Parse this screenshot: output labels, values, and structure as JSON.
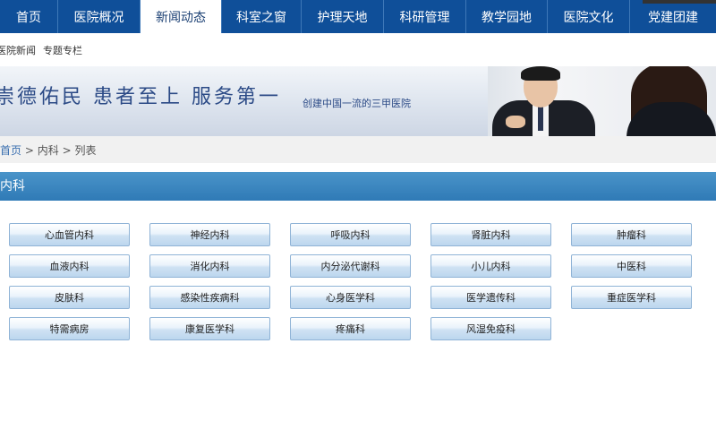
{
  "nav": {
    "items": [
      {
        "label": "首页"
      },
      {
        "label": "医院概况"
      },
      {
        "label": "新闻动态"
      },
      {
        "label": "科室之窗"
      },
      {
        "label": "护理天地"
      },
      {
        "label": "科研管理"
      },
      {
        "label": "教学园地"
      },
      {
        "label": "医院文化"
      },
      {
        "label": "党建团建"
      }
    ],
    "active_index": 2
  },
  "subnav": {
    "items": [
      {
        "label": "医院新闻"
      },
      {
        "label": "专题专栏"
      }
    ]
  },
  "banner": {
    "slogan": "崇德佑民  患者至上   服务第一",
    "tagline": "创建中国一流的三甲医院"
  },
  "breadcrumb": {
    "home": "首页",
    "sep1": ">",
    "section": "内科",
    "sep2": ">",
    "current": "列表"
  },
  "section": {
    "title": "内科"
  },
  "departments": [
    {
      "label": "心血管内科"
    },
    {
      "label": "神经内科"
    },
    {
      "label": "呼吸内科"
    },
    {
      "label": "肾脏内科"
    },
    {
      "label": "肿瘤科"
    },
    {
      "label": "血液内科"
    },
    {
      "label": "消化内科"
    },
    {
      "label": "内分泌代谢科"
    },
    {
      "label": "小儿内科"
    },
    {
      "label": "中医科"
    },
    {
      "label": "皮肤科"
    },
    {
      "label": "感染性疾病科"
    },
    {
      "label": "心身医学科"
    },
    {
      "label": "医学遗传科"
    },
    {
      "label": "重症医学科"
    },
    {
      "label": "特需病房"
    },
    {
      "label": "康复医学科"
    },
    {
      "label": "疼痛科"
    },
    {
      "label": "风湿免疫科"
    }
  ],
  "colors": {
    "nav_bg": "#0f4f99",
    "section_header": "#3a86c0",
    "link": "#3a6fb0"
  }
}
